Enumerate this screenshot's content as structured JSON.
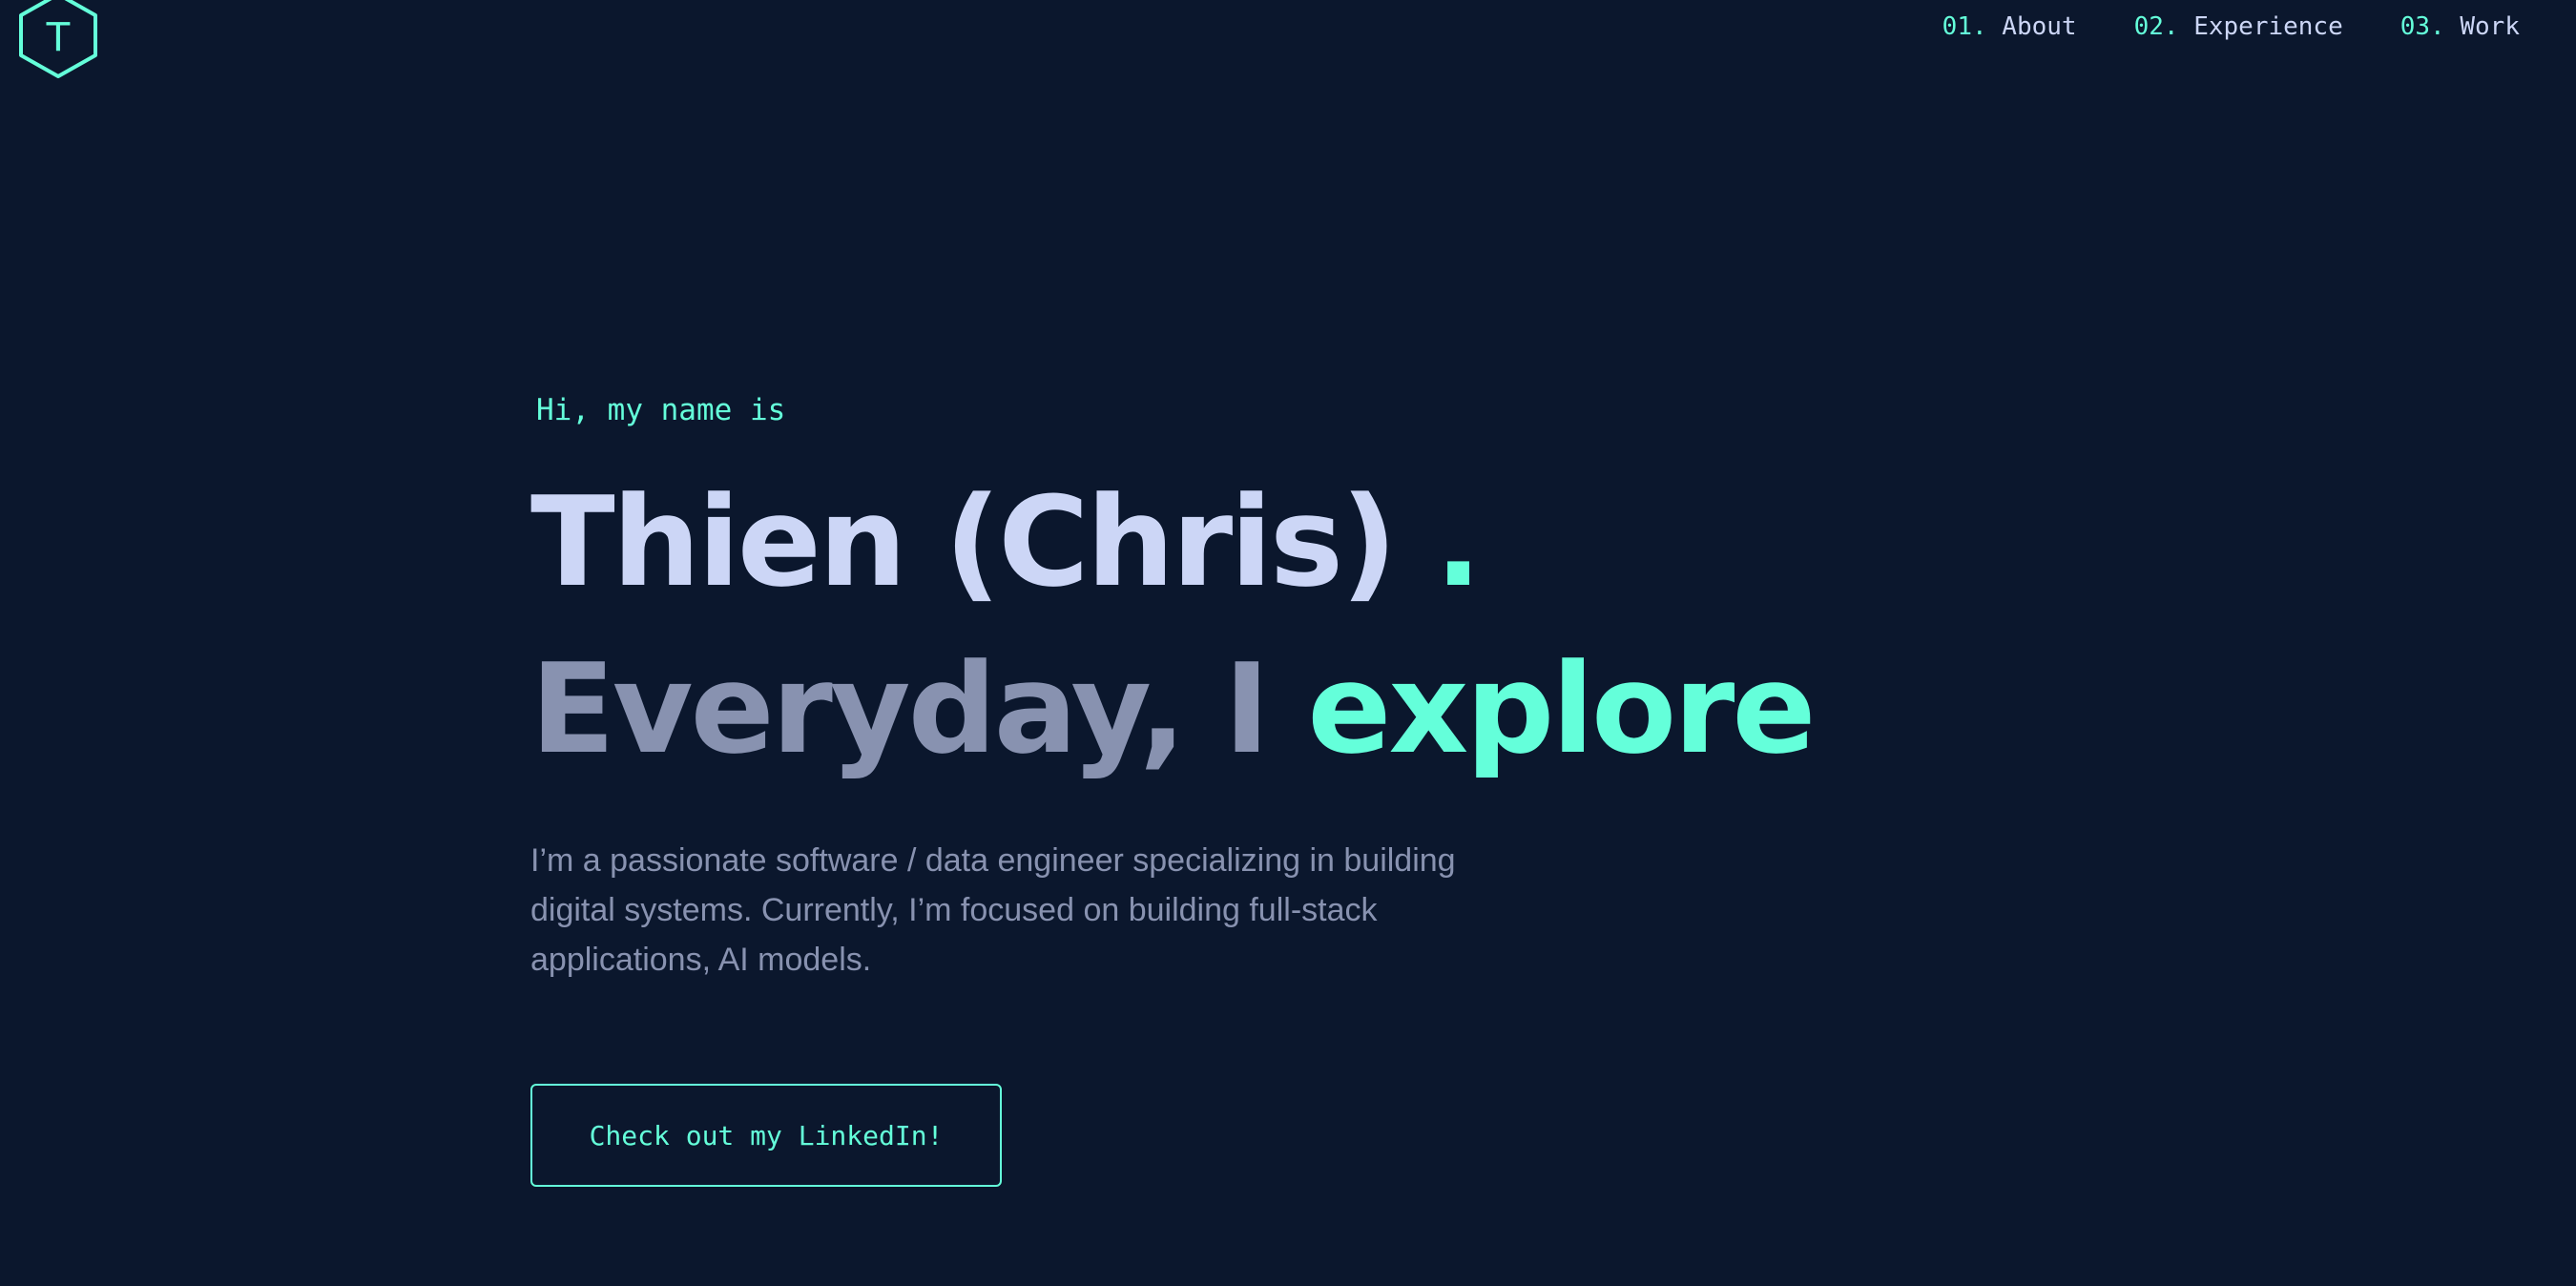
{
  "logo": {
    "letter": "T",
    "icon": "hexagon-logo-icon"
  },
  "nav": {
    "items": [
      {
        "num": "01.",
        "label": "About"
      },
      {
        "num": "02.",
        "label": "Experience"
      },
      {
        "num": "03.",
        "label": "Work"
      }
    ]
  },
  "hero": {
    "greeting": "Hi, my name is",
    "name": "Thien (Chris) ",
    "name_dot": ".",
    "tagline_prefix": "Everyday, I ",
    "tagline_accent": "explore",
    "bio": "I’m a passionate software / data engineer specializing in building digital systems. Currently, I’m focused on building full-stack applications, AI models.",
    "cta_label": "Check out my LinkedIn!"
  },
  "colors": {
    "background": "#0b172d",
    "accent": "#64ffda",
    "heading": "#ccd6f6",
    "muted": "#8892b0"
  }
}
